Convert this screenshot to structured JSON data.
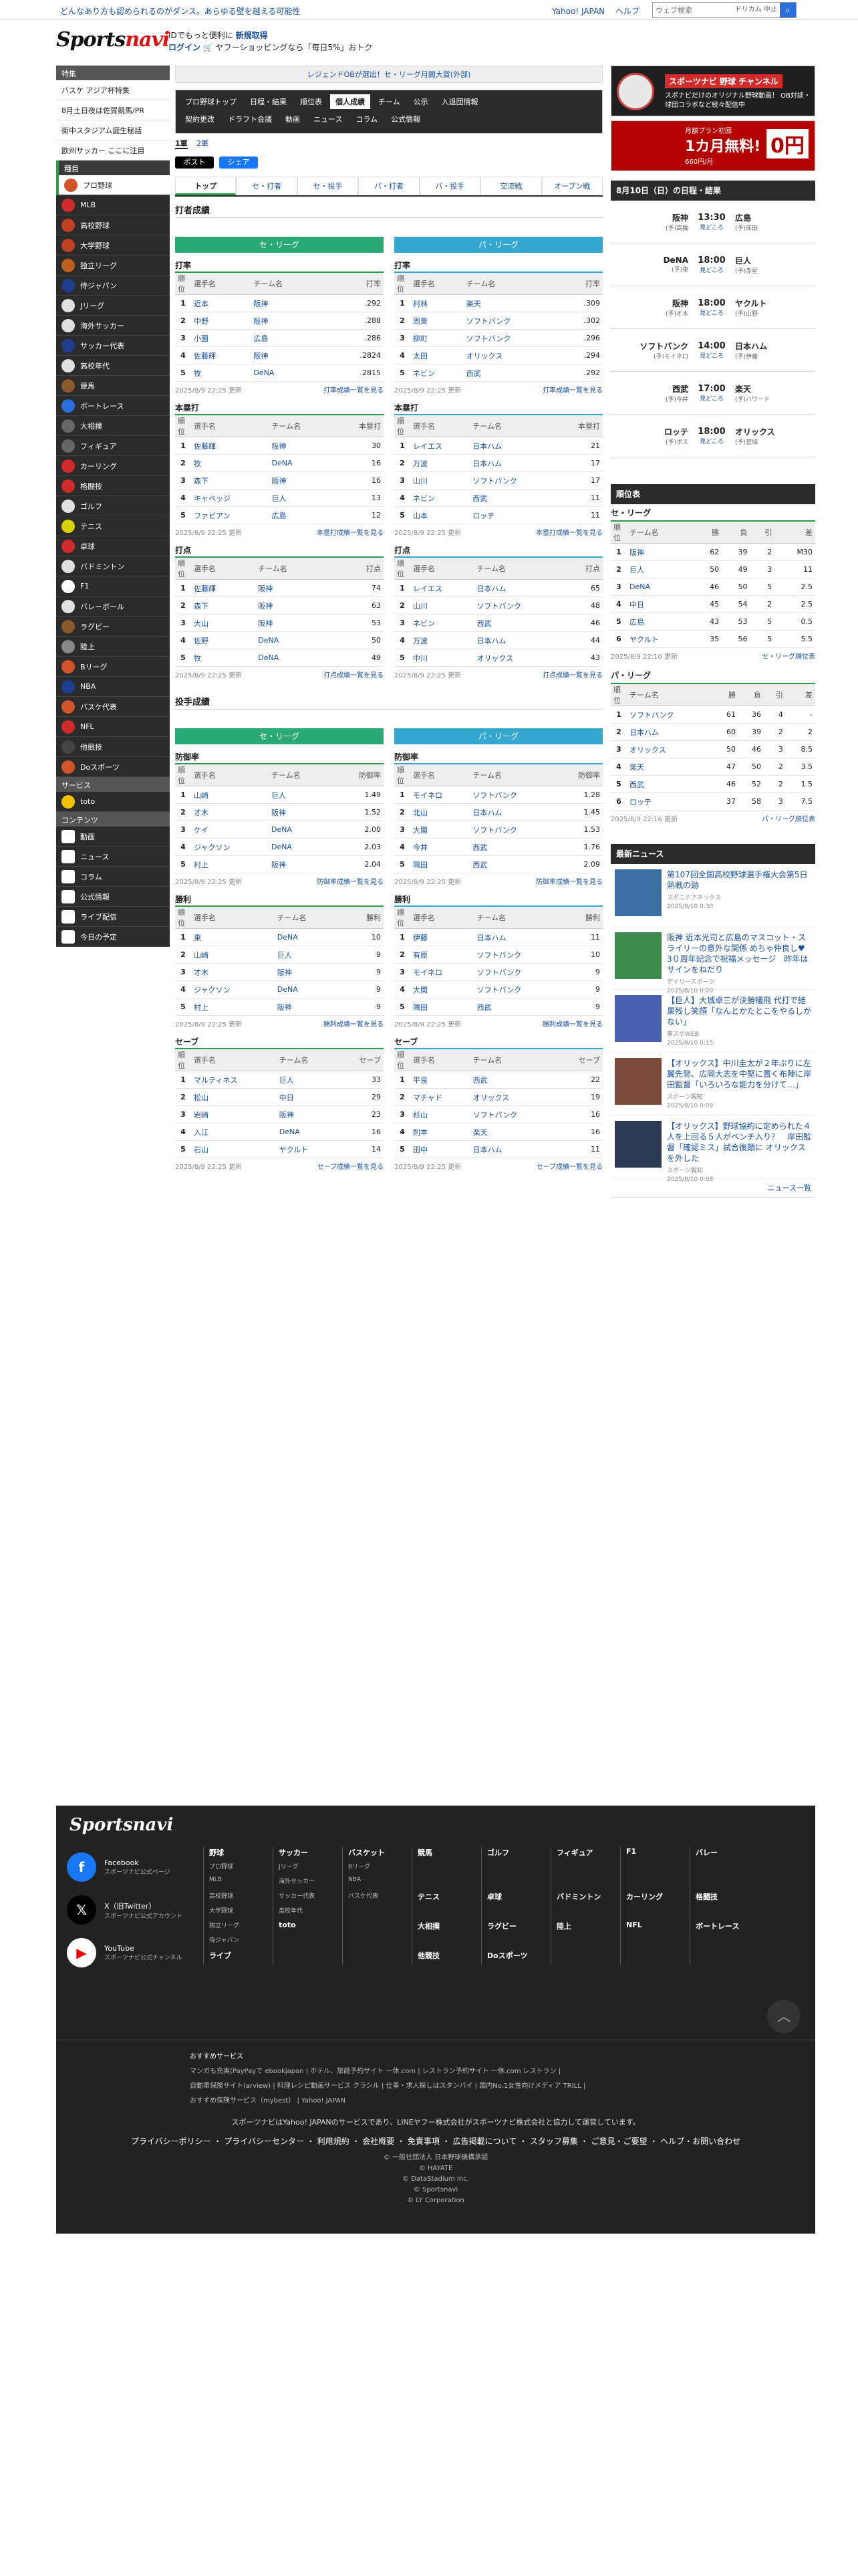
{
  "topbar": {
    "promo": "どんなあり方も認められるのがダンス。あらゆる壁を越える可能性",
    "links": [
      "Yahoo! JAPAN",
      "ヘルプ"
    ],
    "search_placeholder": "ウェブ検索",
    "search_hint": "ドリカム 中止"
  },
  "header": {
    "logo_a": "Sports",
    "logo_b": "navi",
    "line1_prefix": "IDでもっと便利に",
    "line1_link": "新規取得",
    "line2_link": "ログイン",
    "line2_text": "🛒 ヤフーショッピングなら「毎日5%」おトク"
  },
  "sidebar": {
    "sec1": "特集",
    "features": [
      "バスケ アジア杯特集",
      "8月土日夜は佐賀競馬/PR",
      "街中スタジアム誕生秘話",
      "欧州サッカー ここに注目"
    ],
    "sec2": "種目",
    "sports": [
      {
        "label": "プロ野球",
        "color": "#d4542a",
        "icon": "baseball-icon"
      },
      {
        "label": "MLB",
        "color": "#d12b2b",
        "icon": "mlb-icon"
      },
      {
        "label": "高校野球",
        "color": "#c04020",
        "icon": "highschool-baseball-icon"
      },
      {
        "label": "大学野球",
        "color": "#c04020",
        "icon": "college-baseball-icon"
      },
      {
        "label": "独立リーグ",
        "color": "#c06020",
        "icon": "independent-league-icon"
      },
      {
        "label": "侍ジャパン",
        "color": "#1e3f8f",
        "icon": "samurai-japan-icon"
      },
      {
        "label": "Jリーグ",
        "color": "#e0e0e0",
        "icon": "soccer-ball-icon"
      },
      {
        "label": "海外サッカー",
        "color": "#e0e0e0",
        "icon": "soccer-ball-icon"
      },
      {
        "label": "サッカー代表",
        "color": "#1e3f8f",
        "icon": "soccer-national-icon"
      },
      {
        "label": "高校年代",
        "color": "#e0e0e0",
        "icon": "soccer-ball-icon"
      },
      {
        "label": "競馬",
        "color": "#8a5a2a",
        "icon": "horse-icon"
      },
      {
        "label": "ボートレース",
        "color": "#2a6fdb",
        "icon": "boat-icon"
      },
      {
        "label": "大相撲",
        "color": "#666",
        "icon": "sumo-icon"
      },
      {
        "label": "フィギュア",
        "color": "#666",
        "icon": "skate-icon"
      },
      {
        "label": "カーリング",
        "color": "#d12b2b",
        "icon": "curling-icon"
      },
      {
        "label": "格闘技",
        "color": "#d12b2b",
        "icon": "fighting-glove-icon"
      },
      {
        "label": "ゴルフ",
        "color": "#e0e0e0",
        "icon": "golf-icon"
      },
      {
        "label": "テニス",
        "color": "#d8d000",
        "icon": "tennis-ball-icon"
      },
      {
        "label": "卓球",
        "color": "#d12b2b",
        "icon": "table-tennis-icon"
      },
      {
        "label": "バドミントン",
        "color": "#e0e0e0",
        "icon": "shuttlecock-icon"
      },
      {
        "label": "F1",
        "color": "#fff",
        "icon": "f1-flag-icon"
      },
      {
        "label": "バレーボール",
        "color": "#e0e0e0",
        "icon": "volleyball-icon"
      },
      {
        "label": "ラグビー",
        "color": "#8a5a2a",
        "icon": "rugby-ball-icon"
      },
      {
        "label": "陸上",
        "color": "#888",
        "icon": "running-shoe-icon"
      },
      {
        "label": "Bリーグ",
        "color": "#d4542a",
        "icon": "basketball-icon"
      },
      {
        "label": "NBA",
        "color": "#1e3f8f",
        "icon": "nba-icon"
      },
      {
        "label": "バスケ代表",
        "color": "#d4542a",
        "icon": "basketball-icon"
      },
      {
        "label": "NFL",
        "color": "#d12b2b",
        "icon": "nfl-icon"
      },
      {
        "label": "他競技",
        "color": "#444",
        "icon": "other-sports-icon"
      },
      {
        "label": "Doスポーツ",
        "color": "#d4542a",
        "icon": "do-sports-icon"
      }
    ],
    "sec3": "サービス",
    "services": [
      {
        "label": "toto",
        "color": "#f2c100",
        "icon": "toto-icon"
      }
    ],
    "sec4": "コンテンツ",
    "contents": [
      {
        "label": "動画",
        "icon": "video-icon"
      },
      {
        "label": "ニュース",
        "icon": "news-icon"
      },
      {
        "label": "コラム",
        "icon": "column-icon"
      },
      {
        "label": "公式情報",
        "icon": "official-icon"
      },
      {
        "label": "ライブ配信",
        "icon": "live-icon"
      },
      {
        "label": "今日の予定",
        "icon": "calendar-icon"
      }
    ]
  },
  "main": {
    "banner": "レジェンドOBが選出！セ・リーグ月間大賞(外部)",
    "nav_row1": [
      "プロ野球トップ",
      "日程・結果",
      "順位表",
      "個人成績",
      "チーム",
      "公示",
      "入退団情報"
    ],
    "nav_row2": [
      "契約更改",
      "ドラフト会議",
      "動画",
      "ニュース",
      "コラム",
      "公式情報"
    ],
    "nav_active": "個人成績",
    "leagues": [
      "1軍",
      "2軍"
    ],
    "share_x": "ポスト",
    "share_fb": "シェア",
    "tabs": [
      "トップ",
      "セ・打者",
      "セ・投手",
      "パ・打者",
      "パ・投手",
      "交流戦",
      "オープン戦"
    ],
    "batting_title": "打者成績",
    "pitching_title": "投手成績",
    "league_ce": "セ・リーグ",
    "league_pa": "パ・リーグ",
    "ce_color": "#2aa876",
    "pa_color": "#35a7d1",
    "headers": {
      "rank": "順位",
      "player": "選手名",
      "team": "チーム名"
    },
    "tables": [
      {
        "title": "打率",
        "stat": "打率",
        "date": "2025/8/9 22:25 更新",
        "more": "打率成績一覧を見る",
        "ce": [
          [
            "1",
            "近本",
            "阪神",
            ".292"
          ],
          [
            "2",
            "中野",
            "阪神",
            ".288"
          ],
          [
            "3",
            "小園",
            "広島",
            ".286"
          ],
          [
            "4",
            "佐藤輝",
            "阪神",
            ".2824"
          ],
          [
            "5",
            "牧",
            "DeNA",
            ".2815"
          ]
        ],
        "pa": [
          [
            "1",
            "村林",
            "楽天",
            ".309"
          ],
          [
            "2",
            "周東",
            "ソフトバンク",
            ".302"
          ],
          [
            "3",
            "柳町",
            "ソフトバンク",
            ".296"
          ],
          [
            "4",
            "太田",
            "オリックス",
            ".294"
          ],
          [
            "5",
            "ネビン",
            "西武",
            ".292"
          ]
        ]
      },
      {
        "title": "本塁打",
        "stat": "本塁打",
        "date": "2025/8/9 22:25 更新",
        "more": "本塁打成績一覧を見る",
        "ce": [
          [
            "1",
            "佐藤輝",
            "阪神",
            "30"
          ],
          [
            "2",
            "牧",
            "DeNA",
            "16"
          ],
          [
            "3",
            "森下",
            "阪神",
            "16"
          ],
          [
            "4",
            "キャベッジ",
            "巨人",
            "13"
          ],
          [
            "5",
            "ファビアン",
            "広島",
            "12"
          ]
        ],
        "pa": [
          [
            "1",
            "レイエス",
            "日本ハム",
            "21"
          ],
          [
            "2",
            "万波",
            "日本ハム",
            "17"
          ],
          [
            "3",
            "山川",
            "ソフトバンク",
            "17"
          ],
          [
            "4",
            "ネビン",
            "西武",
            "11"
          ],
          [
            "5",
            "山本",
            "ロッテ",
            "11"
          ]
        ]
      },
      {
        "title": "打点",
        "stat": "打点",
        "date": "2025/8/9 22:25 更新",
        "more": "打点成績一覧を見る",
        "ce": [
          [
            "1",
            "佐藤輝",
            "阪神",
            "74"
          ],
          [
            "2",
            "森下",
            "阪神",
            "63"
          ],
          [
            "3",
            "大山",
            "阪神",
            "53"
          ],
          [
            "4",
            "佐野",
            "DeNA",
            "50"
          ],
          [
            "5",
            "牧",
            "DeNA",
            "49"
          ]
        ],
        "pa": [
          [
            "1",
            "レイエス",
            "日本ハム",
            "65"
          ],
          [
            "2",
            "山川",
            "ソフトバンク",
            "48"
          ],
          [
            "3",
            "ネビン",
            "西武",
            "46"
          ],
          [
            "4",
            "万波",
            "日本ハム",
            "44"
          ],
          [
            "5",
            "中川",
            "オリックス",
            "43"
          ]
        ]
      }
    ],
    "ptables": [
      {
        "title": "防御率",
        "stat": "防御率",
        "date": "2025/8/9 22:25 更新",
        "more": "防御率成績一覧を見る",
        "ce": [
          [
            "1",
            "山崎",
            "巨人",
            "1.49"
          ],
          [
            "2",
            "才木",
            "阪神",
            "1.52"
          ],
          [
            "3",
            "ケイ",
            "DeNA",
            "2.00"
          ],
          [
            "4",
            "ジャクソン",
            "DeNA",
            "2.03"
          ],
          [
            "5",
            "村上",
            "阪神",
            "2.04"
          ]
        ],
        "pa": [
          [
            "1",
            "モイネロ",
            "ソフトバンク",
            "1.28"
          ],
          [
            "2",
            "北山",
            "日本ハム",
            "1.45"
          ],
          [
            "3",
            "大関",
            "ソフトバンク",
            "1.53"
          ],
          [
            "4",
            "今井",
            "西武",
            "1.76"
          ],
          [
            "5",
            "隅田",
            "西武",
            "2.09"
          ]
        ]
      },
      {
        "title": "勝利",
        "stat": "勝利",
        "date": "2025/8/9 22:25 更新",
        "more": "勝利成績一覧を見る",
        "ce": [
          [
            "1",
            "東",
            "DeNA",
            "10"
          ],
          [
            "2",
            "山崎",
            "巨人",
            "9"
          ],
          [
            "3",
            "才木",
            "阪神",
            "9"
          ],
          [
            "4",
            "ジャクソン",
            "DeNA",
            "9"
          ],
          [
            "5",
            "村上",
            "阪神",
            "9"
          ]
        ],
        "pa": [
          [
            "1",
            "伊藤",
            "日本ハム",
            "11"
          ],
          [
            "2",
            "有原",
            "ソフトバンク",
            "10"
          ],
          [
            "3",
            "モイネロ",
            "ソフトバンク",
            "9"
          ],
          [
            "4",
            "大関",
            "ソフトバンク",
            "9"
          ],
          [
            "5",
            "隅田",
            "西武",
            "9"
          ]
        ]
      },
      {
        "title": "セーブ",
        "stat": "セーブ",
        "date": "2025/8/9 22:25 更新",
        "more": "セーブ成績一覧を見る",
        "ce": [
          [
            "1",
            "マルティネス",
            "巨人",
            "33"
          ],
          [
            "2",
            "松山",
            "中日",
            "29"
          ],
          [
            "3",
            "岩崎",
            "阪神",
            "23"
          ],
          [
            "4",
            "入江",
            "DeNA",
            "16"
          ],
          [
            "5",
            "石山",
            "ヤクルト",
            "14"
          ]
        ],
        "pa": [
          [
            "1",
            "平良",
            "西武",
            "22"
          ],
          [
            "2",
            "マチャド",
            "オリックス",
            "19"
          ],
          [
            "3",
            "杉山",
            "ソフトバンク",
            "16"
          ],
          [
            "4",
            "則本",
            "楽天",
            "16"
          ],
          [
            "5",
            "田中",
            "日本ハム",
            "11"
          ]
        ]
      }
    ]
  },
  "right": {
    "ad1_title": "スポーツナビ 野球 チャンネル",
    "ad1_text": "スポナビだけのオリジナル野球動画！ OB対談・球団コラボなど続々配信中",
    "ad2_title": "月額プラン初回",
    "ad2_big": "1カ月無料!",
    "ad2_sub": "660円/月",
    "ad2_badge": "0円",
    "schedule_title": "8月10日（日）の日程・結果",
    "games": [
      {
        "home": "阪神",
        "hp": "(予)高橋",
        "time": "13:30",
        "link": "見どころ",
        "away": "広島",
        "ap": "(予)床田"
      },
      {
        "home": "DeNA",
        "hp": "(予)東",
        "time": "18:00",
        "link": "見どころ",
        "away": "巨人",
        "ap": "(予)赤星"
      },
      {
        "home": "阪神",
        "hp": "(予)才木",
        "time": "18:00",
        "link": "見どころ",
        "away": "ヤクルト",
        "ap": "(予)山野"
      },
      {
        "home": "ソフトバンク",
        "hp": "(予)モイネロ",
        "time": "14:00",
        "link": "見どころ",
        "away": "日本ハム",
        "ap": "(予)伊藤"
      },
      {
        "home": "西武",
        "hp": "(予)今井",
        "time": "17:00",
        "link": "見どころ",
        "away": "楽天",
        "ap": "(予)ハワード"
      },
      {
        "home": "ロッテ",
        "hp": "(予)ボス",
        "time": "18:00",
        "link": "見どころ",
        "away": "オリックス",
        "ap": "(予)宮城"
      }
    ],
    "standings_title": "順位表",
    "st_headers": [
      "順位",
      "チーム名",
      "勝",
      "負",
      "引",
      "差"
    ],
    "ce_title": "セ・リーグ",
    "ce_rows": [
      [
        "1",
        "阪神",
        "62",
        "39",
        "2",
        "M30"
      ],
      [
        "2",
        "巨人",
        "50",
        "49",
        "3",
        "11"
      ],
      [
        "3",
        "DeNA",
        "46",
        "50",
        "5",
        "2.5"
      ],
      [
        "4",
        "中日",
        "45",
        "54",
        "2",
        "2.5"
      ],
      [
        "5",
        "広島",
        "43",
        "53",
        "5",
        "0.5"
      ],
      [
        "6",
        "ヤクルト",
        "35",
        "56",
        "5",
        "5.5"
      ]
    ],
    "ce_date": "2025/8/9 22:10 更新",
    "ce_more": "セ・リーグ順位表",
    "pa_title": "パ・リーグ",
    "pa_rows": [
      [
        "1",
        "ソフトバンク",
        "61",
        "36",
        "4",
        "-"
      ],
      [
        "2",
        "日本ハム",
        "60",
        "39",
        "2",
        "2"
      ],
      [
        "3",
        "オリックス",
        "50",
        "46",
        "3",
        "8.5"
      ],
      [
        "4",
        "楽天",
        "47",
        "50",
        "2",
        "3.5"
      ],
      [
        "5",
        "西武",
        "46",
        "52",
        "2",
        "1.5"
      ],
      [
        "6",
        "ロッテ",
        "37",
        "58",
        "3",
        "7.5"
      ]
    ],
    "pa_date": "2025/8/9 22:16 更新",
    "pa_more": "パ・リーグ順位表",
    "news_title": "最新ニュース",
    "news": [
      {
        "title": "第107回全国高校野球選手権大会第5日熱戦の跡",
        "src": "スポニチアネックス",
        "date": "2025/8/10 0:30",
        "color": "#3b6ea5"
      },
      {
        "title": "阪神 近本光司と広島のマスコット・スライリーの意外な関係 めちゃ仲良し♥ 3０周年記念で祝福メッセージ　昨年はサインをねだり",
        "src": "デイリースポーツ",
        "date": "2025/8/10 0:20",
        "color": "#3f8a4f"
      },
      {
        "title": "【巨人】大城卓三が決勝犠飛 代打で結果残し笑顔「なんとかたとこをやるしかない」",
        "src": "東スポWEB",
        "date": "2025/8/10 0:15",
        "color": "#4a5fb0"
      },
      {
        "title": "【オリックス】中川圭太が２年ぶりに左翼先発、広岡大志を中堅に置く布陣に岸田監督「いろいろな能力を分けて…」",
        "src": "スポーツ報知",
        "date": "2025/8/10 0:09",
        "color": "#7a4a3a"
      },
      {
        "title": "【オリックス】野球協約に定められた４人を上回る５人がベンチ入り？　岸田監督「確認ミス」試合後顛に オリックスを外した",
        "src": "スポーツ報知",
        "date": "2025/8/10 0:08",
        "color": "#2d3a55"
      }
    ],
    "news_more": "ニュース一覧"
  },
  "footer": {
    "logo": "Sportsnavi",
    "social": [
      {
        "name": "Facebook",
        "sub": "スポーツナビ公式ページ",
        "color": "#1877f2",
        "glyph": "f"
      },
      {
        "name": "X（旧Twitter）",
        "sub": "スポーツナビ公式アカウント",
        "color": "#000",
        "glyph": "𝕏"
      },
      {
        "name": "YouTube",
        "sub": "スポーツナビ公式チャンネル",
        "color": "#fff",
        "glyph": "▶"
      }
    ],
    "cols": [
      {
        "head": "野球",
        "items": [
          "プロ野球",
          "MLB",
          "高校野球",
          "大学野球",
          "独立リーグ",
          "侍ジャパン"
        ],
        "extra": "ライブ"
      },
      {
        "head": "サッカー",
        "items": [
          "Jリーグ",
          "海外サッカー",
          "サッカー代表",
          "高校年代"
        ],
        "extra": "toto"
      },
      {
        "head": "バスケット",
        "items": [
          "Bリーグ",
          "NBA",
          "バスケ代表"
        ],
        "extra": ""
      },
      {
        "head": "競馬",
        "items": [
          "",
          "",
          "テニス",
          "",
          "大相撲",
          "",
          "他競技"
        ],
        "extra": ""
      },
      {
        "head": "ゴルフ",
        "items": [
          "",
          "",
          "卓球",
          "",
          "ラグビー",
          "",
          "Doスポーツ"
        ],
        "extra": ""
      },
      {
        "head": "フィギュア",
        "items": [
          "",
          "",
          "バドミントン",
          "",
          "陸上"
        ],
        "extra": ""
      },
      {
        "head": "F1",
        "items": [
          "",
          "",
          "カーリング",
          "",
          "NFL"
        ],
        "extra": ""
      },
      {
        "head": "バレー",
        "items": [
          "",
          "",
          "格闘技",
          "",
          "ボートレース"
        ],
        "extra": ""
      }
    ],
    "svc_title": "おすすめサービス",
    "svc_line1": "マンガも充実(PayPayで ebookjapan  |  ホテル、旅館予約サイト 一休.com  |  レストラン予約サイト 一休.com レストラン  |",
    "svc_line2": "自動車保険サイト(arview)  |  料理レシピ動画サービス クラシル  |  仕事・求人探しはスタンバイ  |  国内No.1女性向けメディア TRILL  |",
    "svc_line3": "おすすめ保険サービス（mybest）  |  Yahoo! JAPAN",
    "notice": "スポーツナビはYahoo! JAPANのサービスであり、LINEヤフー株式会社がスポーツナビ株式会社と協力して運営しています。",
    "policy": "プライバシーポリシー ・ プライバシーセンター ・ 利用規約 ・ 会社概要 ・ 免責事項 ・ 広告掲載について ・ スタッフ募集 ・ ご意見・ご要望 ・ ヘルプ・お問い合わせ",
    "copy": [
      "© 一般社団法人 日本野球機構承認",
      "© HAYATE",
      "© DataStadium Inc.",
      "© Sportsnavi",
      "© LY Corporation"
    ],
    "totop": "︿"
  }
}
